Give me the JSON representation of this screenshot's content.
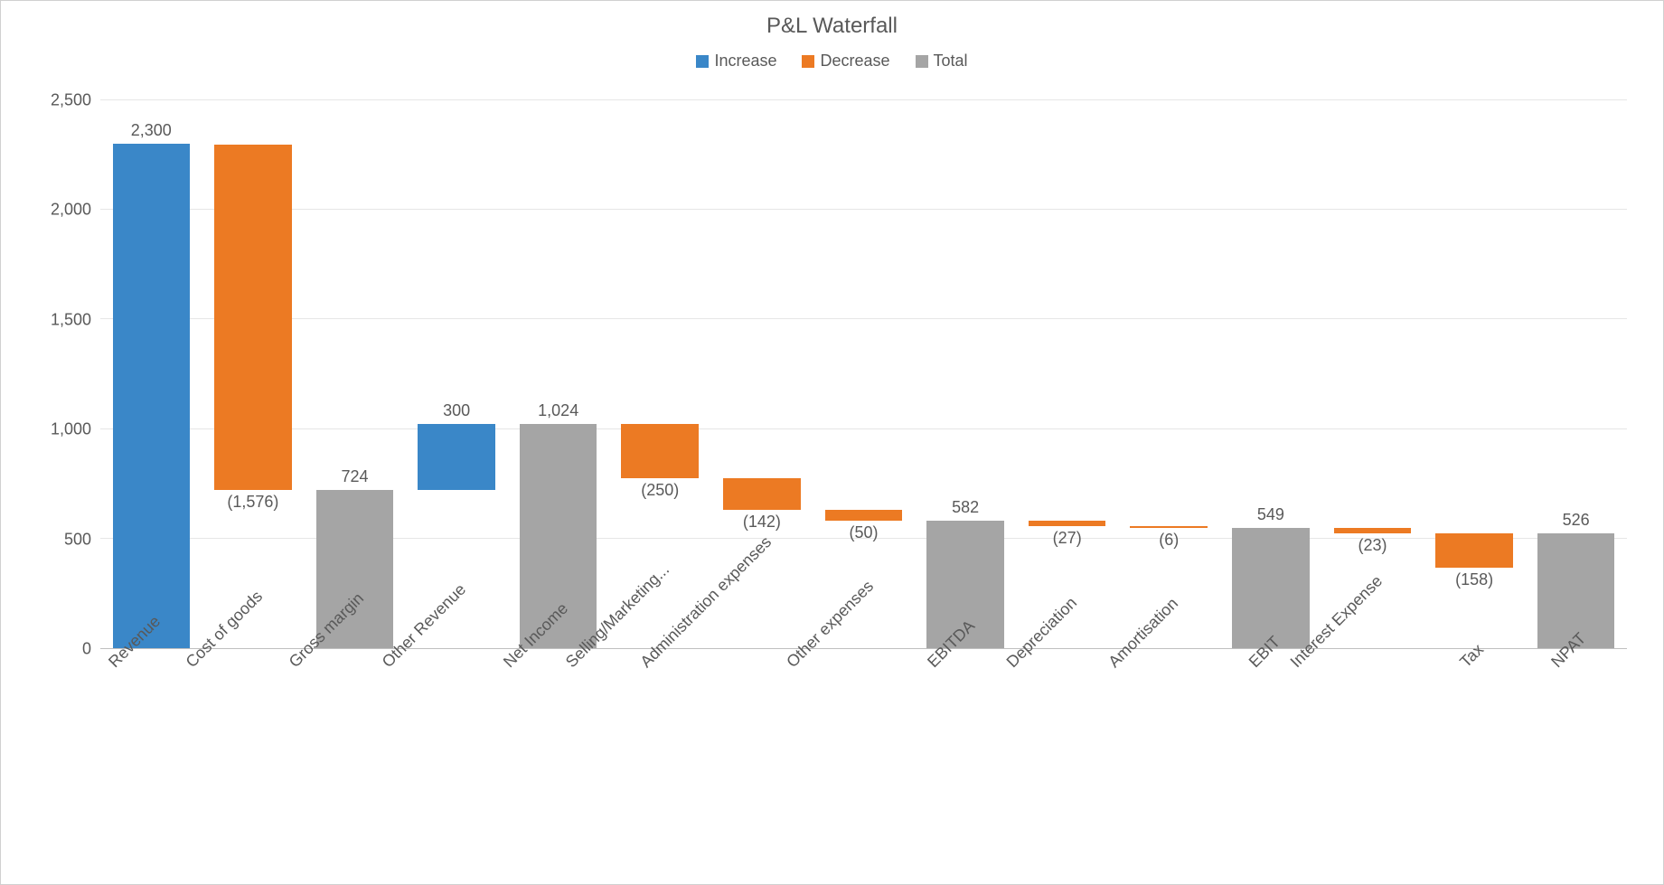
{
  "chart_data": {
    "type": "waterfall",
    "title": "P&L Waterfall",
    "ylim": [
      0,
      2500
    ],
    "y_ticks": [
      0,
      500,
      1000,
      1500,
      2000,
      2500
    ],
    "y_tick_labels": [
      "0",
      "500",
      "1,000",
      "1,500",
      "2,000",
      "2,500"
    ],
    "legend": [
      {
        "name": "Increase",
        "color": "#3a87c8"
      },
      {
        "name": "Decrease",
        "color": "#ec7a23"
      },
      {
        "name": "Total",
        "color": "#a5a5a5"
      }
    ],
    "colors": {
      "increase": "#3a87c8",
      "decrease": "#ec7a23",
      "total": "#a5a5a5"
    },
    "categories": [
      "Revenue",
      "Cost of goods",
      "Gross margin",
      "Other Revenue",
      "Net Income",
      "Selling/Marketing...",
      "Administration expenses",
      "Other expenses",
      "EBITDA",
      "Depreciation",
      "Amortisation",
      "EBIT",
      "Interest Expense",
      "Tax",
      "NPAT"
    ],
    "items": [
      {
        "kind": "increase",
        "value": 2300,
        "label": "2,300",
        "base": 0,
        "top": 2300,
        "label_at": "top"
      },
      {
        "kind": "decrease",
        "value": -1576,
        "label": "(1,576)",
        "base": 724,
        "top": 2300,
        "label_at": "bottom"
      },
      {
        "kind": "total",
        "value": 724,
        "label": "724",
        "base": 0,
        "top": 724,
        "label_at": "top"
      },
      {
        "kind": "increase",
        "value": 300,
        "label": "300",
        "base": 724,
        "top": 1024,
        "label_at": "top"
      },
      {
        "kind": "total",
        "value": 1024,
        "label": "1,024",
        "base": 0,
        "top": 1024,
        "label_at": "top"
      },
      {
        "kind": "decrease",
        "value": -250,
        "label": "(250)",
        "base": 774,
        "top": 1024,
        "label_at": "bottom"
      },
      {
        "kind": "decrease",
        "value": -142,
        "label": "(142)",
        "base": 632,
        "top": 774,
        "label_at": "bottom"
      },
      {
        "kind": "decrease",
        "value": -50,
        "label": "(50)",
        "base": 582,
        "top": 632,
        "label_at": "bottom"
      },
      {
        "kind": "total",
        "value": 582,
        "label": "582",
        "base": 0,
        "top": 582,
        "label_at": "top"
      },
      {
        "kind": "decrease",
        "value": -27,
        "label": "(27)",
        "base": 555,
        "top": 582,
        "label_at": "bottom"
      },
      {
        "kind": "decrease",
        "value": -6,
        "label": "(6)",
        "base": 549,
        "top": 555,
        "label_at": "bottom"
      },
      {
        "kind": "total",
        "value": 549,
        "label": "549",
        "base": 0,
        "top": 549,
        "label_at": "top"
      },
      {
        "kind": "decrease",
        "value": -23,
        "label": "(23)",
        "base": 526,
        "top": 549,
        "label_at": "bottom"
      },
      {
        "kind": "decrease",
        "value": -158,
        "label": "(158)",
        "base": 368,
        "top": 526,
        "label_at": "bottom"
      },
      {
        "kind": "total",
        "value": 526,
        "label": "526",
        "base": 0,
        "top": 526,
        "label_at": "top"
      }
    ]
  }
}
